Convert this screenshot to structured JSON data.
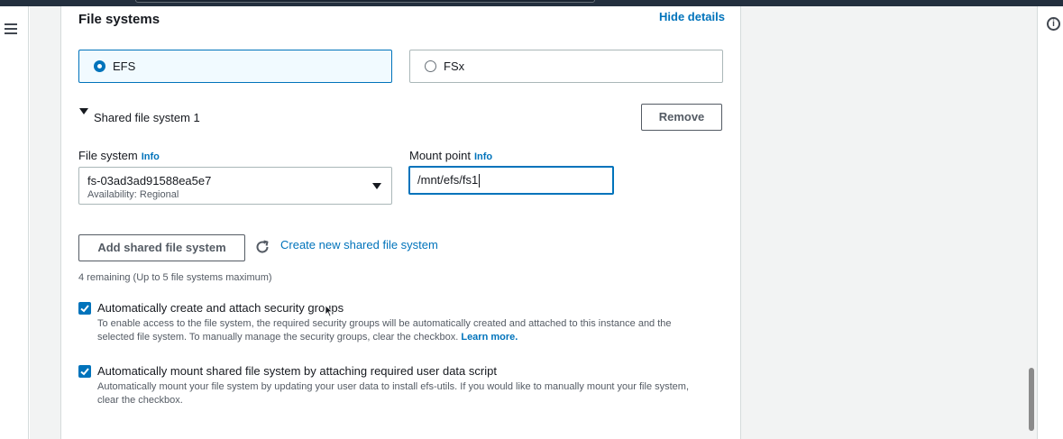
{
  "section": {
    "title": "File systems",
    "hide_details": "Hide details"
  },
  "type_tiles": {
    "efs_label": "EFS",
    "fsx_label": "FSx",
    "selected": "EFS"
  },
  "shared_fs": {
    "expander_label": "Shared file system 1",
    "remove_label": "Remove",
    "file_system_label": "File system",
    "file_system_info": "Info",
    "file_system_value": "fs-03ad3ad91588ea5e7",
    "file_system_sub": "Availability: Regional",
    "mount_point_label": "Mount point",
    "mount_point_info": "Info",
    "mount_point_value": "/mnt/efs/fs1"
  },
  "actions": {
    "add_label": "Add shared file system",
    "create_link": "Create new shared file system",
    "remaining_text": "4 remaining (Up to 5 file systems maximum)"
  },
  "checkboxes": [
    {
      "label": "Automatically create and attach security groups",
      "description": "To enable access to the file system, the required security groups will be automatically created and attached to this instance and the selected file system. To manually manage the security groups, clear the checkbox.",
      "link": "Learn more.",
      "checked": true
    },
    {
      "label": "Automatically mount shared file system by attaching required user data script",
      "description": "Automatically mount your file system by updating your user data to install efs-utils. If you would like to manually mount your file system, clear the checkbox.",
      "checked": true
    }
  ],
  "colors": {
    "accent": "#0073bb",
    "header_bg": "#232f3e",
    "page_bg": "#f2f3f3"
  },
  "icons": [
    "menu-icon",
    "info-icon",
    "refresh-icon",
    "checkbox-checked-icon",
    "caret-down-icon",
    "cursor-pointer-icon"
  ]
}
